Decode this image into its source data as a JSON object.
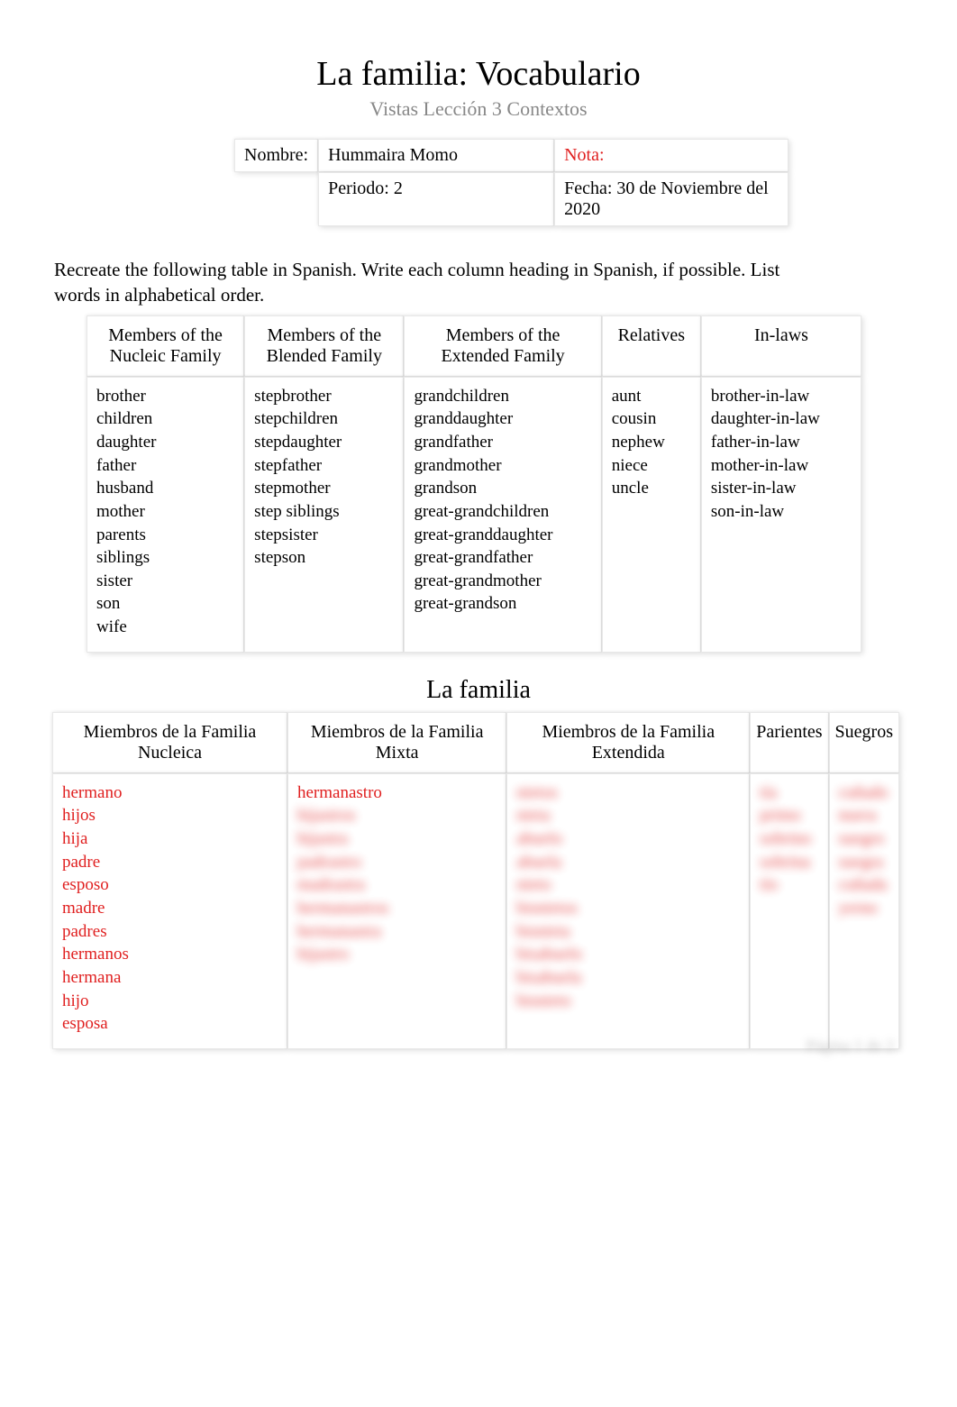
{
  "title": "La familia: Vocabulario",
  "subtitle": "Vistas Lección 3 Contextos",
  "info": {
    "nombre_label": "Nombre:",
    "nombre_value": "Hummaira Momo",
    "nota_label": "Nota:",
    "periodo": "Periodo: 2",
    "fecha": "Fecha: 30 de Noviembre del 2020"
  },
  "instructions": "Recreate the following table in Spanish. Write each column heading in Spanish, if possible. List words in alphabetical order.",
  "table_en": {
    "headers": [
      "Members of the\nNucleic Family",
      "Members of the\nBlended Family",
      "Members of the\nExtended Family",
      "Relatives",
      "In-laws"
    ],
    "cols": [
      [
        "brother",
        "children",
        "daughter",
        "father",
        "husband",
        "mother",
        "parents",
        "siblings",
        "sister",
        "son",
        "wife"
      ],
      [
        "stepbrother",
        "stepchildren",
        "stepdaughter",
        "stepfather",
        "stepmother",
        "step siblings",
        "stepsister",
        "stepson"
      ],
      [
        "grandchildren",
        "granddaughter",
        "grandfather",
        "grandmother",
        "grandson",
        "great-grandchildren",
        "great-granddaughter",
        "great-grandfather",
        "great-grandmother",
        "great-grandson"
      ],
      [
        "aunt",
        "cousin",
        "nephew",
        "niece",
        "uncle"
      ],
      [
        "brother-in-law",
        "daughter-in-law",
        "father-in-law",
        "mother-in-law",
        "sister-in-law",
        "son-in-law"
      ]
    ]
  },
  "section_title": "La familia",
  "table_es": {
    "headers": [
      "Miembros de la Familia Nucleica",
      "Miembros de la Familia Mixta",
      "Miembros de la Familia Extendida",
      "Parientes",
      "Suegros"
    ],
    "cols": [
      {
        "visible": [
          "hermano",
          "hijos",
          "hija",
          "padre",
          "esposo",
          "madre",
          "padres",
          "hermanos",
          "hermana",
          "hijo",
          "esposa"
        ],
        "blurred": []
      },
      {
        "visible": [
          "hermanastro"
        ],
        "blurred": [
          "hijastros",
          "hijastra",
          "padrastro",
          "madrastra",
          "hermanastros",
          "hermanastra",
          "hijastro"
        ]
      },
      {
        "visible": [],
        "blurred": [
          "nietos",
          "nieta",
          "abuelo",
          "abuela",
          "nieto",
          "bisnietos",
          "bisnieta",
          "bisabuelo",
          "bisabuela",
          "bisnieto"
        ]
      },
      {
        "visible": [],
        "blurred": [
          "tía",
          "primo",
          "sobrino",
          "sobrina",
          "tío"
        ]
      },
      {
        "visible": [],
        "blurred": [
          "cuñado",
          "nuera",
          "suegro",
          "suegra",
          "cuñada",
          "yerno"
        ]
      }
    ]
  },
  "footer": "Página 1 de 2"
}
